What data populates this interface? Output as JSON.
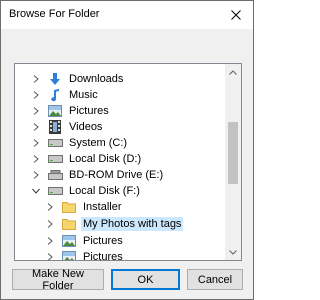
{
  "window": {
    "title": "Browse For Folder",
    "close_symbol": "✕"
  },
  "tree": {
    "items": [
      {
        "label": "Downloads",
        "icon": "downloads-icon",
        "expander": "collapsed"
      },
      {
        "label": "Music",
        "icon": "music-icon",
        "expander": "collapsed"
      },
      {
        "label": "Pictures",
        "icon": "pictures-icon",
        "expander": "collapsed"
      },
      {
        "label": "Videos",
        "icon": "videos-icon",
        "expander": "collapsed"
      },
      {
        "label": "System (C:)",
        "icon": "drive-icon",
        "expander": "collapsed"
      },
      {
        "label": "Local Disk (D:)",
        "icon": "drive-icon",
        "expander": "collapsed"
      },
      {
        "label": "BD-ROM Drive (E:)",
        "icon": "optical-drive-icon",
        "expander": "collapsed"
      },
      {
        "label": "Local Disk (F:)",
        "icon": "drive-icon",
        "expander": "expanded"
      },
      {
        "label": "Installer",
        "icon": "folder-icon",
        "expander": "collapsed"
      },
      {
        "label": "My Photos with tags",
        "icon": "folder-icon",
        "expander": "collapsed",
        "selected": true
      },
      {
        "label": "Pictures",
        "icon": "pictures-icon",
        "expander": "collapsed"
      },
      {
        "label": "Pictures",
        "icon": "pictures-icon",
        "expander": "collapsed"
      }
    ]
  },
  "buttons": {
    "make_new_folder": "Make New Folder",
    "ok": "OK",
    "cancel": "Cancel"
  },
  "colors": {
    "selection": "#cce8ff",
    "folder": "#f5d66c",
    "accent": "#0078d7"
  }
}
